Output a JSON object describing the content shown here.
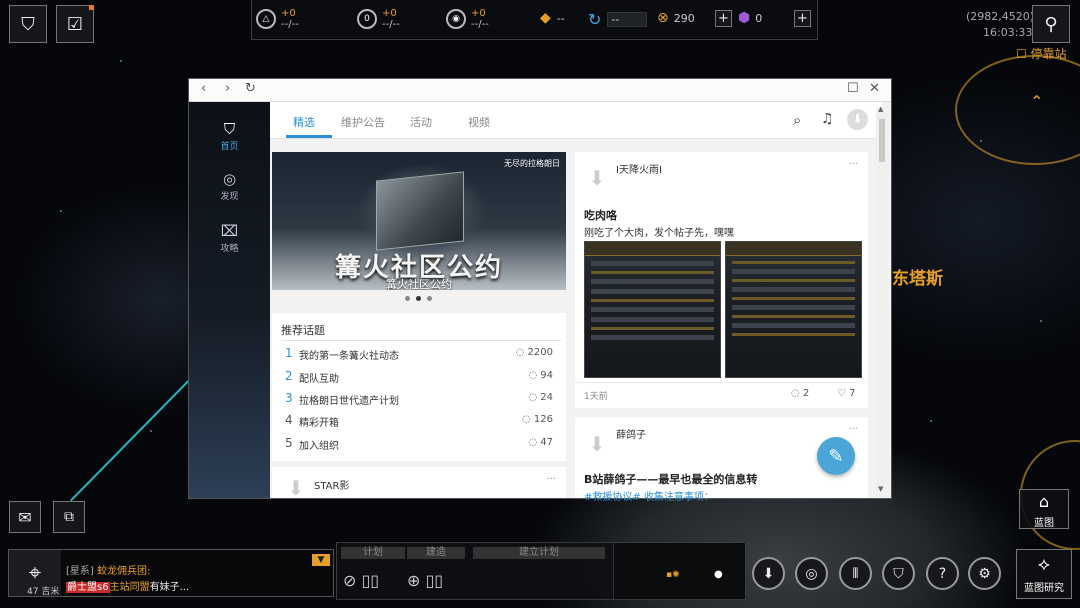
{
  "hud": {
    "resources": [
      {
        "icon": "triangle-icon",
        "delta": "+0",
        "value": "--/--"
      },
      {
        "icon": "capsule-icon",
        "delta": "+0",
        "value": "--/--"
      },
      {
        "icon": "orb-icon",
        "delta": "+0",
        "value": "--/--"
      }
    ],
    "fuel_value": "--",
    "refresh_value": "--",
    "currency_value": "290",
    "premium_value": "0",
    "coords": "(2982,4520)",
    "clock": "16:03:33",
    "dock_label": "停靠站",
    "planet_label": "东塔斯",
    "blueprint_label": "蓝图",
    "blueprint_research_label": "蓝图研究",
    "distance": "47 吉米"
  },
  "browser": {
    "nav": [
      {
        "label": "首页",
        "icon": "shield-logo-icon"
      },
      {
        "label": "发现",
        "icon": "spiral-icon"
      },
      {
        "label": "攻略",
        "icon": "guide-icon"
      }
    ],
    "tabs": [
      "精选",
      "维护公告",
      "活动",
      "视频"
    ],
    "banner": {
      "title": "篝火社区公约",
      "subtitle": "篝火社区公约",
      "brand": "无尽的拉格朗日"
    },
    "topics": {
      "heading": "推荐话题",
      "items": [
        {
          "no": "1",
          "title": "我的第一条篝火社动态",
          "count": "2200"
        },
        {
          "no": "2",
          "title": "配队互助",
          "count": "94"
        },
        {
          "no": "3",
          "title": "拉格朗日世代遗产计划",
          "count": "24"
        },
        {
          "no": "4",
          "title": "精彩开箱",
          "count": "126"
        },
        {
          "no": "5",
          "title": "加入组织",
          "count": "47"
        }
      ]
    },
    "star_card_author": "STAR影",
    "post1": {
      "author": "I天降火雨I",
      "title": "吃肉咯",
      "body": "刚吃了个大肉，发个帖子先，嘿嘿",
      "time": "1天前",
      "comments": "2",
      "likes": "7"
    },
    "post2": {
      "author": "薛鸽子",
      "title": "B站薛鸽子——最早也最全的信息转",
      "body": "#救援协议#   收集注意事项："
    }
  },
  "chat": {
    "line1_channel": "[星系]",
    "line1_text": "蛟龙佣兵团:",
    "line2_prefix": "爵士盟s6",
    "line2_mid": "主站同盟",
    "line2_suffix": "有妹子..."
  },
  "plan": {
    "tab1": "计划",
    "tab2": "建造",
    "tab3": "建立计划"
  },
  "colors": {
    "accent": "#2b8fd6",
    "gold": "#e6a02a",
    "teal_line": "#24b7c2"
  }
}
